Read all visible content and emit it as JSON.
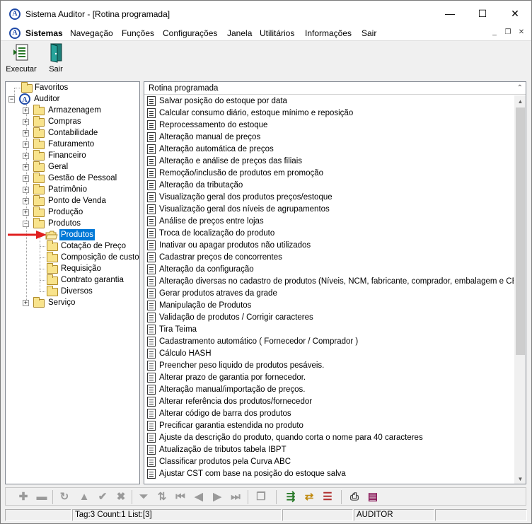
{
  "window": {
    "title": "Sistema Auditor - [Rotina programada]",
    "minimize_glyph": "—",
    "maximize_glyph": "☐",
    "close_glyph": "✕"
  },
  "menubar": {
    "icon_letter": "A",
    "items": [
      "Sistemas",
      "Navegação",
      "Funções",
      "Configurações",
      "Janela",
      "Utilitários",
      "Informações",
      "Sair"
    ]
  },
  "toolbar": {
    "execute_label": "Executar",
    "exit_label": "Sair"
  },
  "tree": {
    "favorites": "Favoritos",
    "root": "Auditor",
    "folders": [
      "Armazenagem",
      "Compras",
      "Contabilidade",
      "Faturamento",
      "Financeiro",
      "Geral",
      "Gestão de Pessoal",
      "Patrimônio",
      "Ponto de Venda",
      "Produção",
      "Produtos"
    ],
    "produtos_children": [
      "Produtos",
      "Cotação de Preço",
      "Composição de custo",
      "Requisição",
      "Contrato garantia",
      "Diversos"
    ],
    "last_folder": "Serviço",
    "selected": "Produtos"
  },
  "list": {
    "header": "Rotina programada",
    "items": [
      "Salvar posição do estoque por data",
      "Calcular consumo diário, estoque mínimo e reposição",
      "Reprocessamento do estoque",
      "Alteração manual de preços",
      "Alteração automática de preços",
      "Alteração e análise de preços das filiais",
      "Remoção/inclusão de produtos em promoção",
      "Alteração da tributação",
      "Visualização geral dos produtos preços/estoque",
      "Visualização geral dos níveis de agrupamentos",
      "Análise de preços entre lojas",
      "Troca de localização do produto",
      "Inativar ou apagar produtos não utilizados",
      "Cadastrar preços de concorrentes",
      "Alteração da configuração",
      "Alteração diversas no cadastro de produtos (Níveis, NCM, fabricante, comprador,  embalagem e CEST) ...",
      "Gerar produtos atraves da grade",
      "Manipulação de Produtos",
      "Validação de produtos / Corrigir caracteres",
      "Tira Teima",
      "Cadastramento automático ( Fornecedor / Comprador )",
      "Cálculo HASH",
      "Preencher peso liquido de produtos pesáveis.",
      "Alterar prazo de garantia por fornecedor.",
      "Alteração manual/importação de preços.",
      "Alterar referência dos produtos/fornecedor",
      "Alterar código de barra dos produtos",
      "Precificar garantia estendida no produto",
      "Ajuste da descrição do produto, quando corta o nome para 40 caracteres",
      "Atualização de tributos tabela IBPT",
      "Classificar produtos pela Curva ABC",
      "Ajustar CST com base na posição do estoque salva"
    ]
  },
  "statusbar": {
    "panel1": "",
    "panel2": "Tag:3 Count:1 List:[3]",
    "panel3": "",
    "panel4": "AUDITOR",
    "panel5": ""
  },
  "colors": {
    "selection": "#0078d7",
    "arrow": "#e02020",
    "folder": "#f8e38c"
  }
}
